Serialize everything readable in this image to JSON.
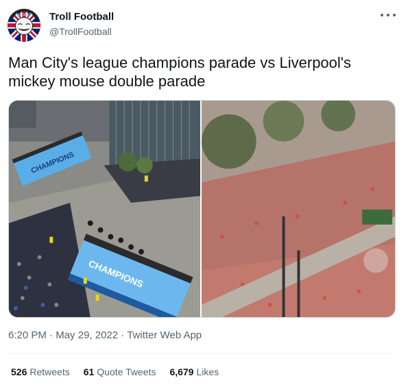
{
  "author": {
    "display_name": "Troll Football",
    "handle": "@TrollFootball",
    "avatar_text": "SOCCER",
    "avatar_icon": "troll-face-union-jack-badge"
  },
  "more_icon": "more-horizontal-icon",
  "tweet": {
    "text": "Man City's league champions parade vs Liverpool's mickey mouse double parade"
  },
  "media": {
    "images": [
      {
        "subject": "man-city-parade-bus",
        "bus_text_top": "CHAMPIONS",
        "bus_text_side": "CHAMPIONS"
      },
      {
        "subject": "liverpool-parade-crowd",
        "sign_text": ""
      }
    ]
  },
  "meta": {
    "time": "6:20 PM",
    "separator": "·",
    "date": "May 29, 2022",
    "source": "Twitter Web App"
  },
  "stats": {
    "retweets_count": "526",
    "retweets_label": "Retweets",
    "quotes_count": "61",
    "quotes_label": "Quote Tweets",
    "likes_count": "6,679",
    "likes_label": "Likes"
  },
  "colors": {
    "text_primary": "#0f1419",
    "text_secondary": "#536471",
    "city_blue": "#5aaee8",
    "liverpool_red": "#c8102e"
  }
}
